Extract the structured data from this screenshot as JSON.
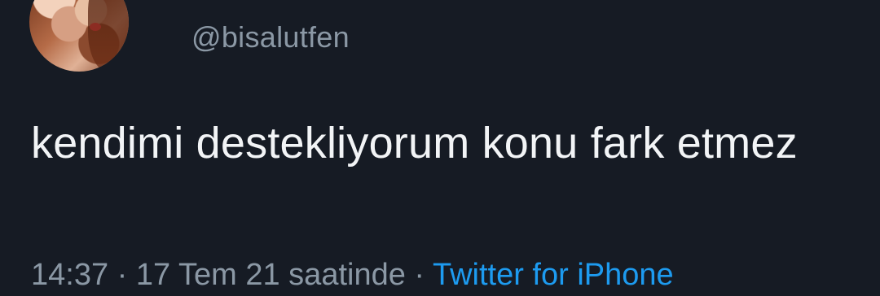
{
  "tweet": {
    "handle": "@bisalutfen",
    "text": "kendimi destekliyorum konu fark etmez",
    "time": "14:37",
    "date": "17 Tem 21 saatinde",
    "separator": "·",
    "source": "Twitter for iPhone"
  },
  "colors": {
    "background": "#161b24",
    "text": "#f2f4f6",
    "muted": "#8b98a5",
    "link": "#1d9bf0"
  }
}
